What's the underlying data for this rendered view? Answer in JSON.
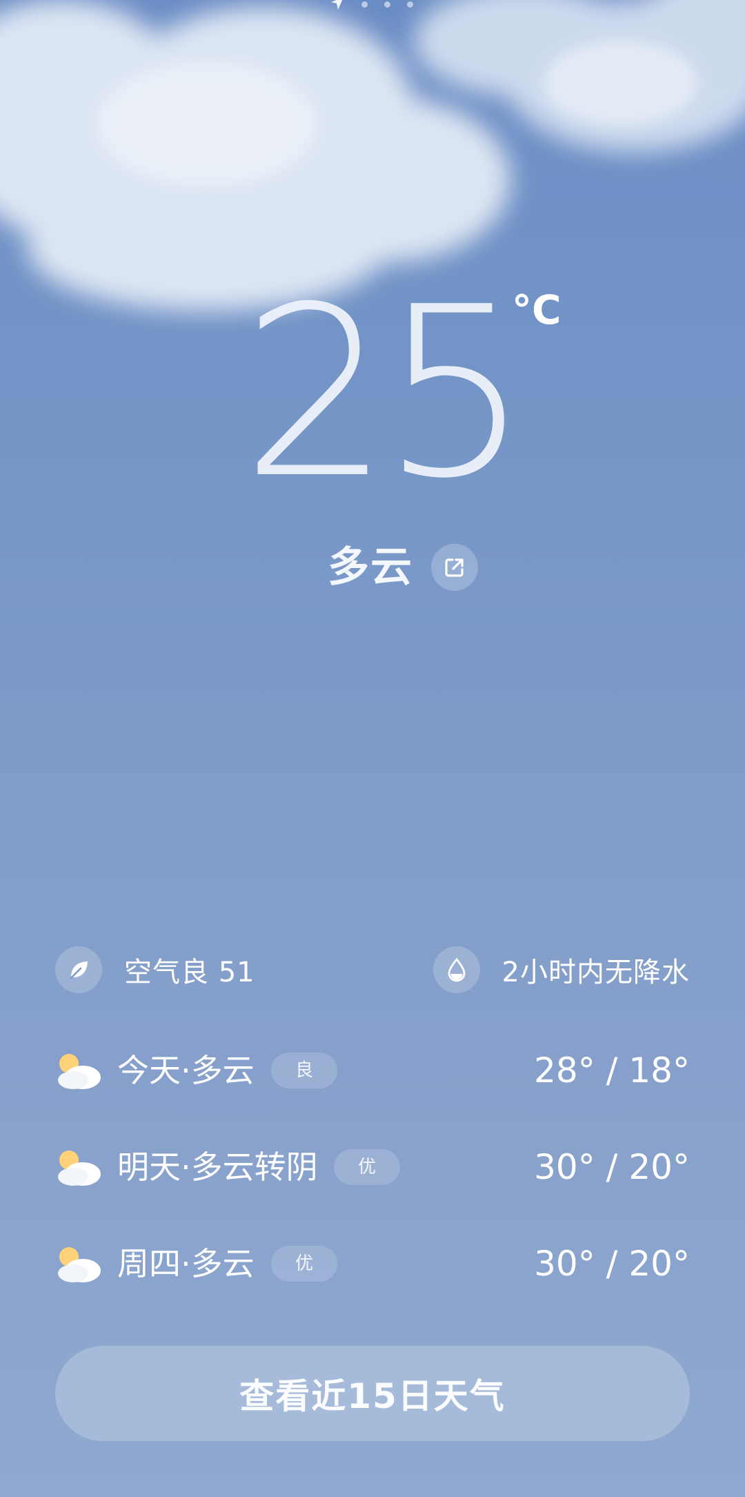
{
  "header": {
    "page_count": 4,
    "active_page": 0
  },
  "current": {
    "temperature": "25",
    "unit": "°C",
    "condition": "多云"
  },
  "info": {
    "air_quality": "空气良 51",
    "precipitation": "2小时内无降水"
  },
  "forecast": [
    {
      "label": "今天·多云",
      "badge": "良",
      "temps": "28° / 18°",
      "icon": "partly-cloudy-icon"
    },
    {
      "label": "明天·多云转阴",
      "badge": "优",
      "temps": "30° / 20°",
      "icon": "partly-cloudy-icon"
    },
    {
      "label": "周四·多云",
      "badge": "优",
      "temps": "30° / 20°",
      "icon": "partly-cloudy-icon"
    }
  ],
  "cta": {
    "label": "查看近15日天气"
  },
  "colors": {
    "sky_top": "#6a8cc4",
    "sky_bottom": "#8fa9d0",
    "sun": "#ffd27a"
  }
}
